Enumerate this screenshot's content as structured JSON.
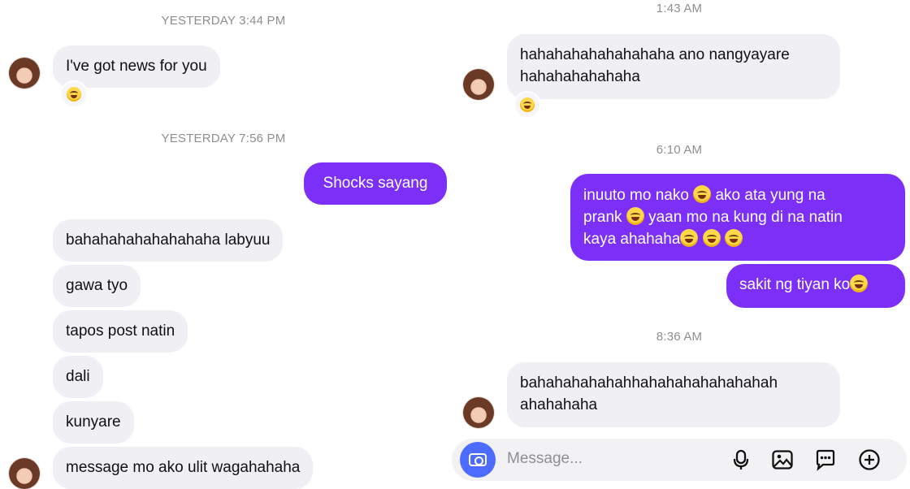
{
  "left_column": {
    "timestamps": [
      "YESTERDAY 3:44 PM",
      "YESTERDAY 7:56 PM"
    ],
    "incoming_1": "I've got news for you",
    "outgoing_1": "Shocks sayang",
    "incoming_2": [
      "bahahahahahahahaha labyuu",
      "gawa tyo",
      "tapos post natin",
      "dali",
      "kunyare",
      "message mo ako ulit wagahahaha"
    ]
  },
  "right_column": {
    "timestamps": [
      "1:43 AM",
      "6:10 AM",
      "8:36 AM"
    ],
    "incoming_1": [
      "hahahahahahahahaha ano nangyayare",
      "hahahahahahaha"
    ],
    "outgoing_1": [
      "inuuto mo nako",
      "ako ata yung na",
      "prank",
      "yaan mo na kung di na natin",
      "kaya ahahaha"
    ],
    "outgoing_2": "sakit ng tiyan ko",
    "incoming_2": [
      "bahahahahahahhahahahahahahahah",
      "ahahahaha"
    ]
  },
  "composer": {
    "placeholder": "Message...",
    "icons": [
      "camera-icon",
      "microphone-icon",
      "image-icon",
      "sticker-icon",
      "add-icon"
    ]
  },
  "colors": {
    "outgoing_bubble": "#7b2ff7",
    "incoming_bubble": "#efeff4",
    "camera_button": "#4d6bfe",
    "timestamp_text": "#8e8e93"
  }
}
